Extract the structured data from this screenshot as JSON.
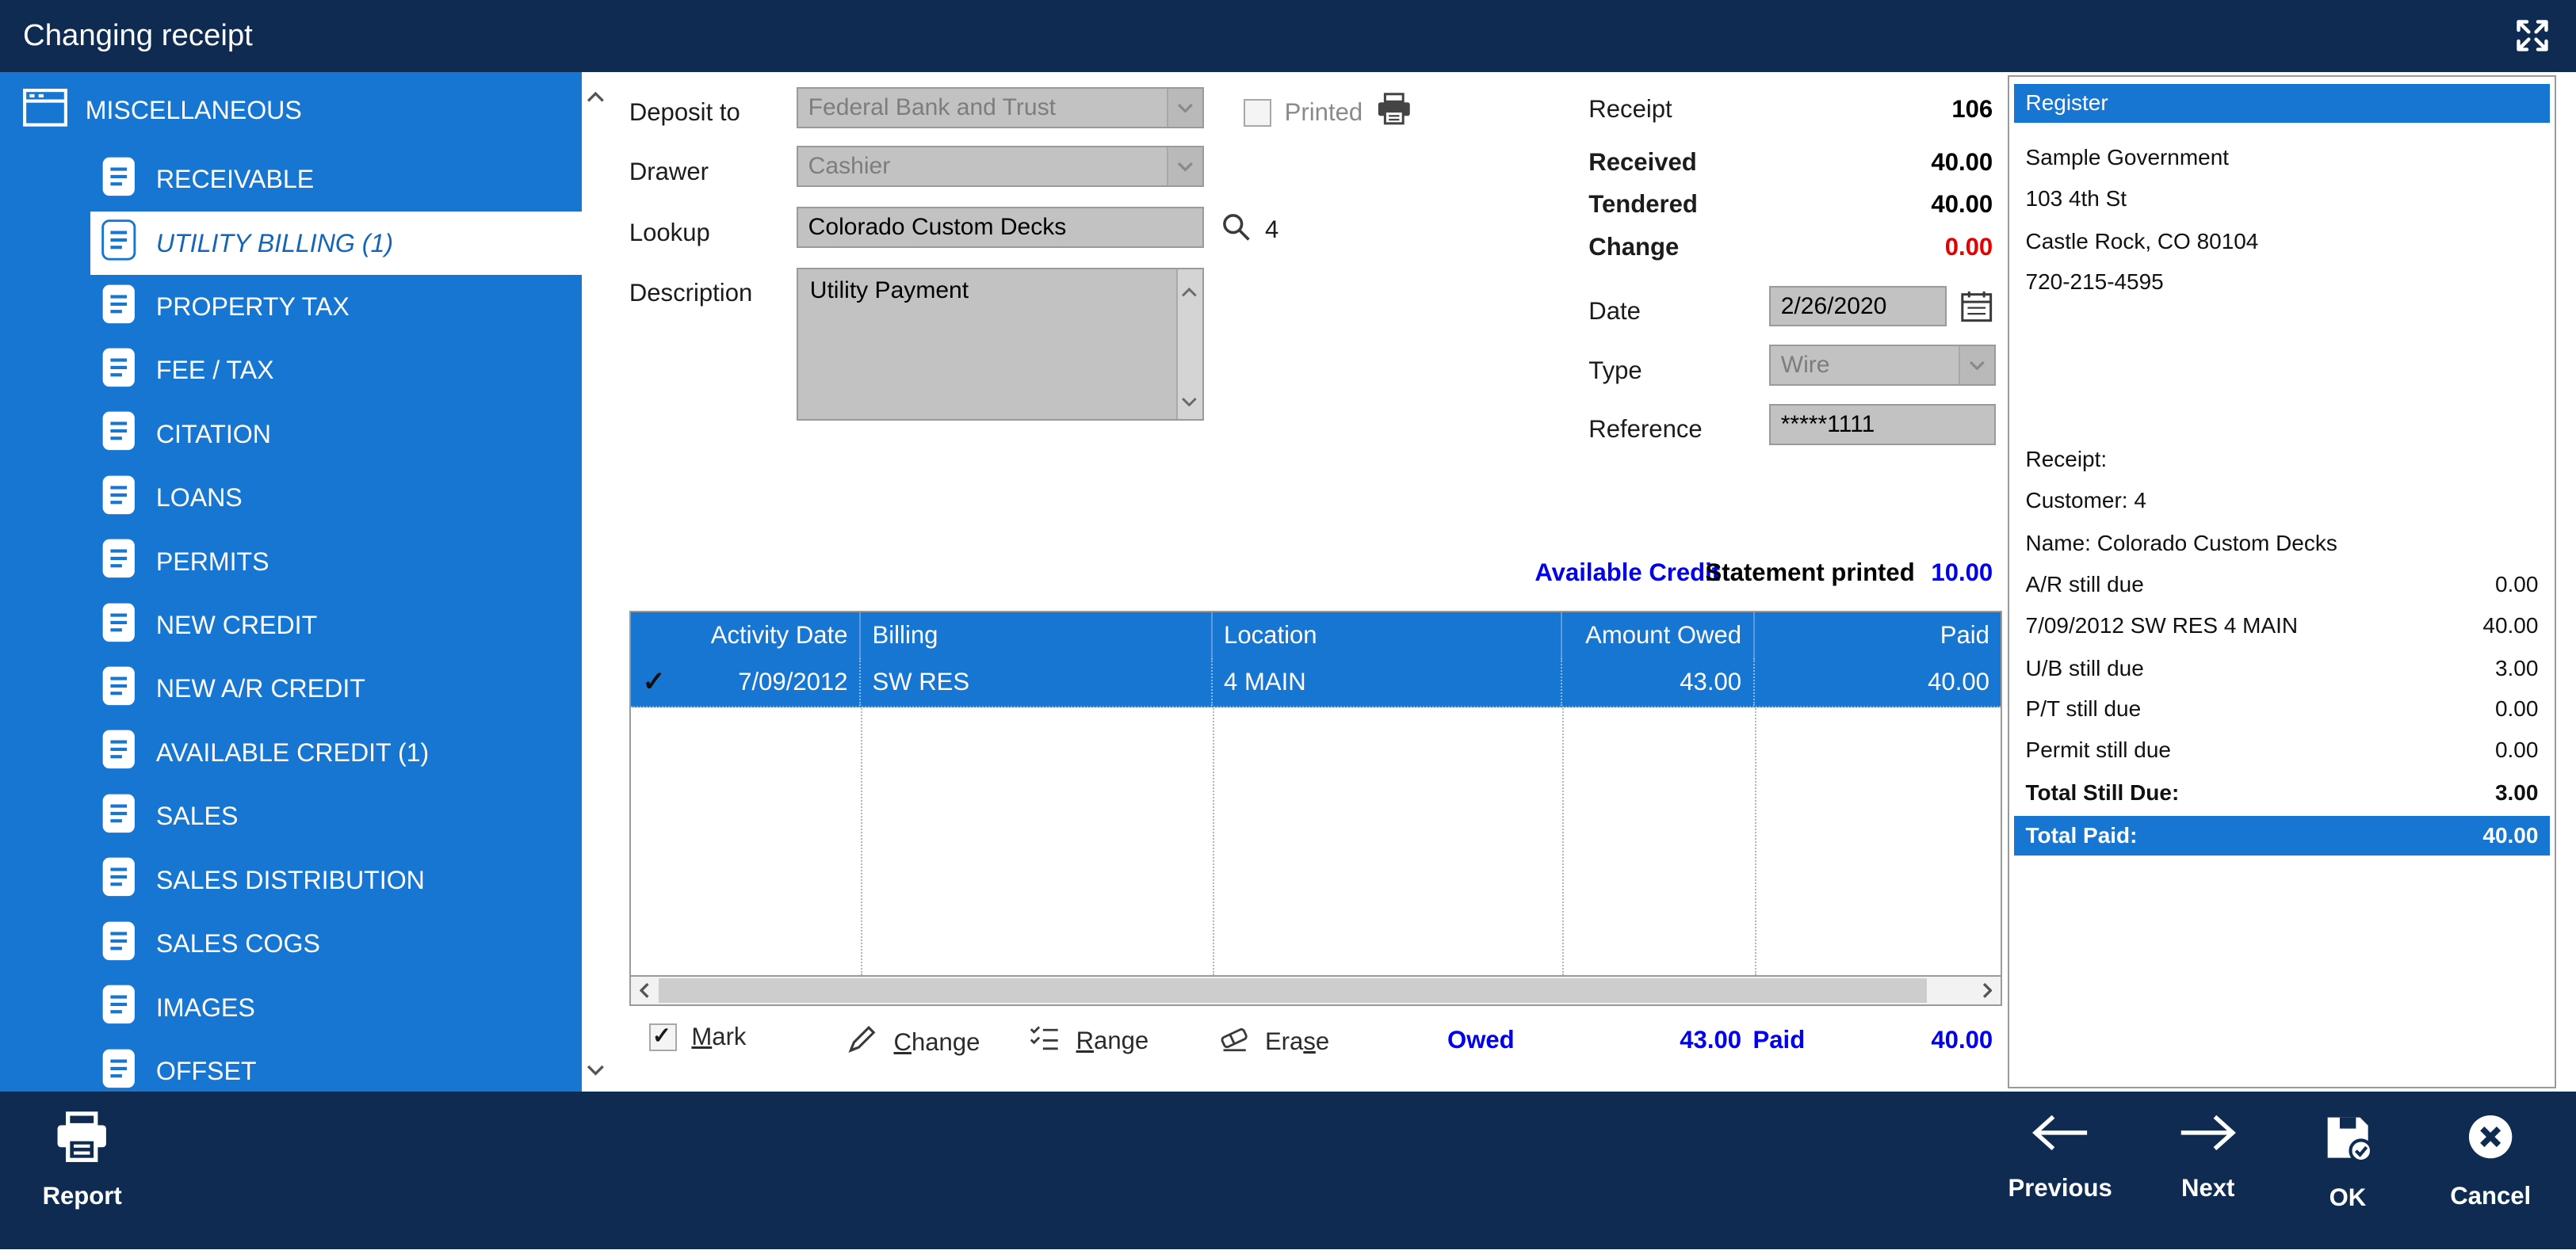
{
  "window": {
    "title": "Changing receipt"
  },
  "colors": {
    "navy": "#0f2b52",
    "blue": "#1776d2",
    "accent_text": "#0000eb",
    "negative": "#e60000",
    "field_bg": "#c2c2c2"
  },
  "icons": {
    "maximize": "expand-arrows",
    "group": "window",
    "item": "document",
    "printed": "printer",
    "lookup": "magnifier",
    "date": "calendar",
    "mark": "checkbox-checked",
    "change": "pencil",
    "range": "checklist",
    "erase": "eraser",
    "report": "printer",
    "previous": "arrow-left",
    "next": "arrow-right",
    "ok": "floppy-check",
    "cancel": "circle-x"
  },
  "sidebar": {
    "header": "MISCELLANEOUS",
    "items": [
      {
        "label": "RECEIVABLE"
      },
      {
        "label": "UTILITY BILLING (1)",
        "selected": true
      },
      {
        "label": "PROPERTY TAX"
      },
      {
        "label": "FEE / TAX"
      },
      {
        "label": "CITATION"
      },
      {
        "label": "LOANS"
      },
      {
        "label": "PERMITS"
      },
      {
        "label": "NEW CREDIT"
      },
      {
        "label": "NEW A/R CREDIT"
      },
      {
        "label": "AVAILABLE CREDIT (1)"
      },
      {
        "label": "SALES"
      },
      {
        "label": "SALES DISTRIBUTION"
      },
      {
        "label": "SALES COGS"
      },
      {
        "label": "IMAGES"
      },
      {
        "label": "OFFSET"
      }
    ]
  },
  "form": {
    "deposit_to": {
      "label": "Deposit to",
      "value": "Federal Bank and Trust",
      "disabled": true
    },
    "printed": {
      "label": "Printed",
      "checked": false,
      "disabled": true
    },
    "drawer": {
      "label": "Drawer",
      "value": "Cashier",
      "disabled": true
    },
    "lookup": {
      "label": "Lookup",
      "value": "Colorado Custom Decks",
      "result_count": "4"
    },
    "description": {
      "label": "Description",
      "value": "Utility Payment"
    },
    "receipt": {
      "label": "Receipt",
      "value": "106"
    },
    "received": {
      "label": "Received",
      "value": "40.00"
    },
    "tendered": {
      "label": "Tendered",
      "value": "40.00"
    },
    "change": {
      "label": "Change",
      "value": "0.00"
    },
    "date": {
      "label": "Date",
      "value": "2/26/2020"
    },
    "type": {
      "label": "Type",
      "value": "Wire",
      "disabled": true
    },
    "reference": {
      "label": "Reference",
      "value": "*****1111"
    },
    "available_credit": {
      "label": "Available Credit",
      "value": "10.00"
    },
    "statement_printed": "Statement printed"
  },
  "grid": {
    "columns": [
      "Activity Date",
      "Billing",
      "Location",
      "Amount Owed",
      "Paid"
    ],
    "rows": [
      {
        "checked": true,
        "activity_date": "7/09/2012",
        "billing": "SW RES",
        "location": "4 MAIN",
        "amount_owed": "43.00",
        "paid": "40.00",
        "selected": true
      }
    ],
    "actions": {
      "mark": {
        "pre": "",
        "key": "M",
        "post": "ark"
      },
      "change": {
        "pre": "",
        "key": "C",
        "post": "hange"
      },
      "range": {
        "pre": "",
        "key": "R",
        "post": "ange"
      },
      "erase": {
        "pre": "Era",
        "key": "s",
        "post": "e"
      }
    },
    "totals": {
      "owed_label": "Owed",
      "owed": "43.00",
      "paid_label": "Paid",
      "paid": "40.00"
    }
  },
  "register": {
    "title": "Register",
    "address": [
      "Sample Government",
      "103 4th St",
      "Castle Rock, CO 80104",
      "720-215-4595"
    ],
    "lines": [
      {
        "label": "Receipt:",
        "amount": ""
      },
      {
        "label": "Customer: 4",
        "amount": ""
      },
      {
        "label": "Name: Colorado Custom Decks",
        "amount": ""
      },
      {
        "label": "A/R still due",
        "amount": "0.00"
      },
      {
        "label": "7/09/2012 SW RES 4 MAIN",
        "amount": "40.00"
      },
      {
        "label": "U/B still due",
        "amount": "3.00"
      },
      {
        "label": "P/T still due",
        "amount": "0.00"
      },
      {
        "label": "Permit still due",
        "amount": "0.00"
      },
      {
        "label": "Total Still Due:",
        "amount": "3.00"
      },
      {
        "label": "Total Paid:",
        "amount": "40.00"
      }
    ]
  },
  "bottom_bar": {
    "report": "Report",
    "previous": "Previous",
    "next": "Next",
    "ok": "OK",
    "cancel": "Cancel"
  }
}
